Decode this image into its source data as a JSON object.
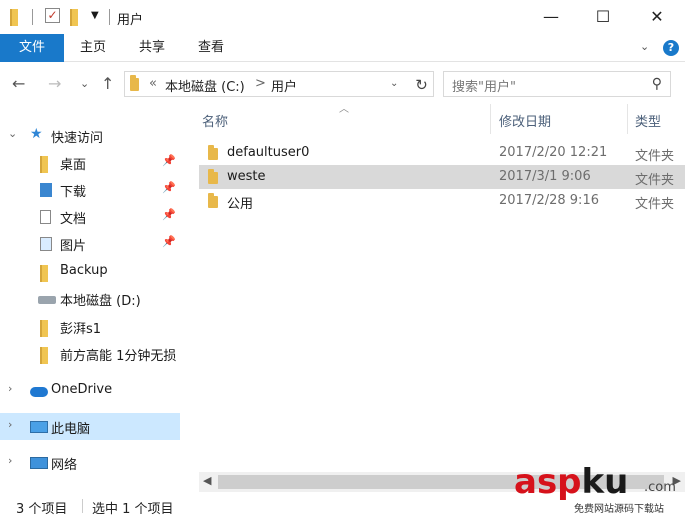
{
  "window": {
    "title": "用户",
    "controls": {
      "minimize": "—",
      "maximize": "☐",
      "close": "✕"
    }
  },
  "ribbon": {
    "file_tab": "文件",
    "tabs": [
      "主页",
      "共享",
      "查看"
    ]
  },
  "address": {
    "overflow": "«",
    "segments": [
      "本地磁盘 (C:)",
      "用户"
    ],
    "separator": ">",
    "search_placeholder": "搜索\"用户\""
  },
  "navpane": {
    "quick_access": "快速访问",
    "quick_items": [
      {
        "label": "桌面",
        "icon": "folder-icon",
        "pinned": true
      },
      {
        "label": "下载",
        "icon": "download-icon",
        "pinned": true
      },
      {
        "label": "文档",
        "icon": "document-icon",
        "pinned": true
      },
      {
        "label": "图片",
        "icon": "picture-icon",
        "pinned": true
      },
      {
        "label": "Backup",
        "icon": "folder-icon",
        "pinned": false
      },
      {
        "label": "本地磁盘 (D:)",
        "icon": "drive-icon",
        "pinned": false
      },
      {
        "label": "彭湃s1",
        "icon": "folder-icon",
        "pinned": false
      },
      {
        "label": "前方高能 1分钟无损",
        "icon": "folder-icon",
        "pinned": false
      }
    ],
    "onedrive": "OneDrive",
    "this_pc": "此电脑",
    "network": "网络"
  },
  "columns": {
    "name": "名称",
    "date": "修改日期",
    "type": "类型"
  },
  "files": [
    {
      "name": "defaultuser0",
      "date": "2017/2/20 12:21",
      "type": "文件夹"
    },
    {
      "name": "weste",
      "date": "2017/3/1 9:06",
      "type": "文件夹"
    },
    {
      "name": "公用",
      "date": "2017/2/28 9:16",
      "type": "文件夹"
    }
  ],
  "status": {
    "count": "3 个项目",
    "selected": "选中 1 个项目"
  },
  "watermark": {
    "brand_a": "asp",
    "brand_b": "ku",
    "com": ".com",
    "sub": "免费网站源码下载站"
  }
}
